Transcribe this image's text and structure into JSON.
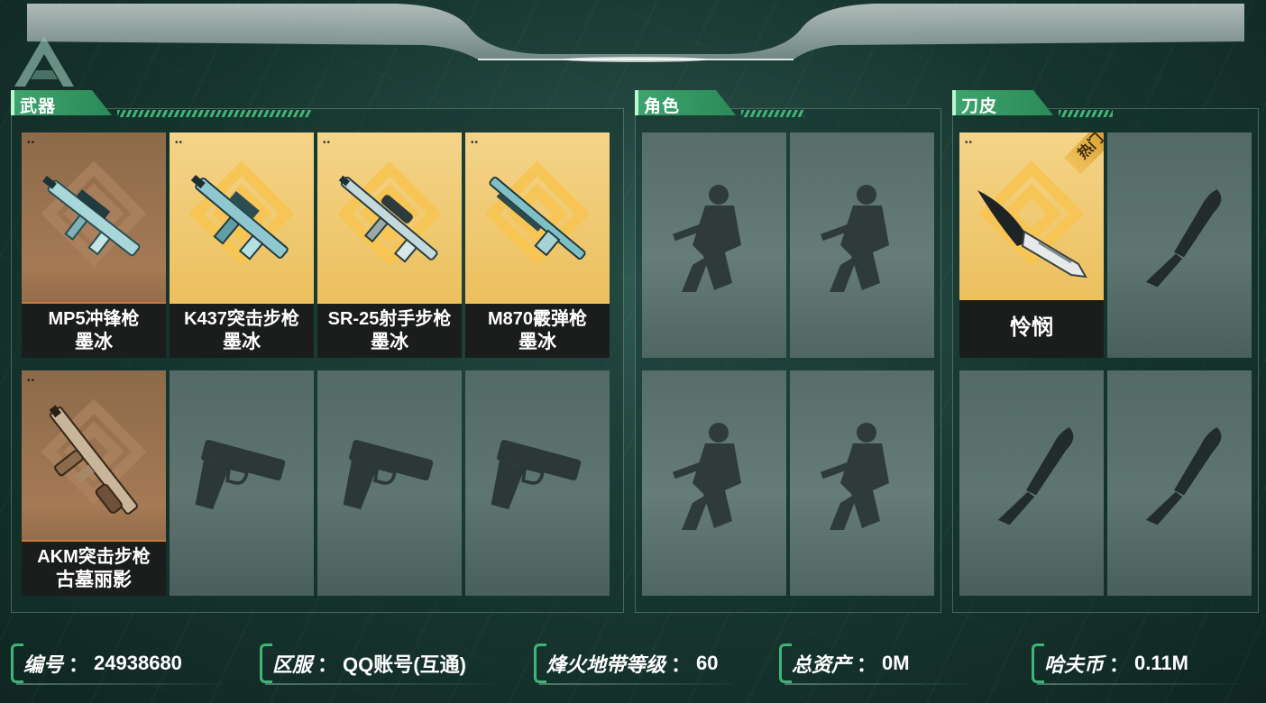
{
  "sections": {
    "weapons": {
      "title": "武器"
    },
    "characters": {
      "title": "角色"
    },
    "knife_skins": {
      "title": "刀皮"
    }
  },
  "weapons": [
    {
      "line1": "MP5冲锋枪",
      "line2": "墨冰",
      "rarity": "bronze"
    },
    {
      "line1": "K437突击步枪",
      "line2": "墨冰",
      "rarity": "gold"
    },
    {
      "line1": "SR-25射手步枪",
      "line2": "墨冰",
      "rarity": "gold"
    },
    {
      "line1": "M870霰弹枪",
      "line2": "墨冰",
      "rarity": "gold"
    },
    {
      "line1": "AKM突击步枪",
      "line2": "古墓丽影",
      "rarity": "bronze"
    }
  ],
  "knives": [
    {
      "name": "怜悯",
      "rarity": "gold",
      "badge": "热门"
    }
  ],
  "info_bar": {
    "id": {
      "label": "编号",
      "value": "24938680"
    },
    "server": {
      "label": "区服",
      "value": "QQ账号(互通)"
    },
    "level": {
      "label": "烽火地带等级",
      "value": "60"
    },
    "assets": {
      "label": "总资产",
      "value": "0M"
    },
    "coins": {
      "label": "哈夫币",
      "value": "0.11M"
    }
  },
  "colors": {
    "accent_green": "#3ea56f",
    "card_gold": "#e9b94f",
    "card_bronze": "#a57a55",
    "slot_empty": "#5e7572"
  },
  "icons": [
    "logo-icon",
    "rifle-icon",
    "shotgun-icon",
    "pistol-silhouette-icon",
    "soldier-silhouette-icon",
    "knife-silhouette-icon",
    "karambit-icon"
  ]
}
